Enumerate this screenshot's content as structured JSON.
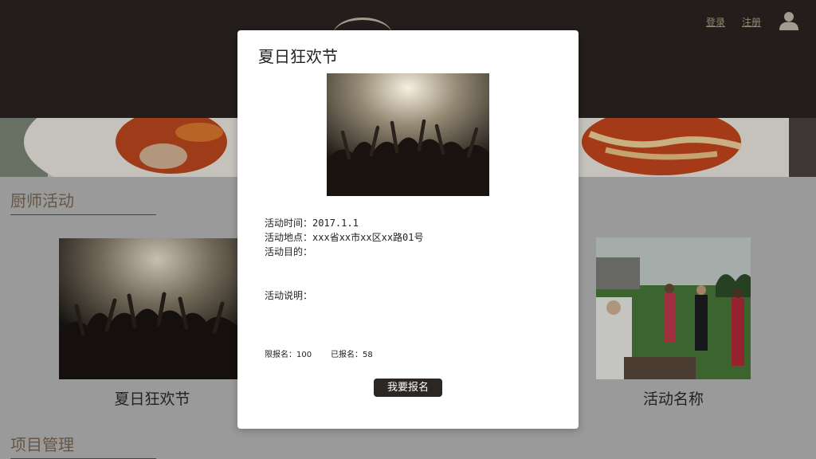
{
  "header": {
    "login_label": "登录",
    "register_label": "注册",
    "avatar_icon": "user-icon"
  },
  "sections": {
    "chef_activities": "厨师活动",
    "project_management": "项目管理"
  },
  "cards": [
    {
      "title": "夏日狂欢节",
      "image": "concert-crowd-photo"
    },
    {
      "title": "活动名称",
      "image": "outdoor-party-photo"
    }
  ],
  "modal": {
    "title": "夏日狂欢节",
    "image": "concert-crowd-photo",
    "time_label": "活动时间：",
    "time_value": "2017.1.1",
    "location_label": "活动地点：",
    "location_value": "xxx省xx市xx区xx路01号",
    "purpose_label": "活动目的：",
    "description_label": "活动说明：",
    "limit_label": "限报名：",
    "limit_value": "100",
    "registered_label": "已报名：",
    "registered_value": "58",
    "signup_button": "我要报名"
  },
  "colors": {
    "header_bg": "#2b2522",
    "accent_gold": "#b5a387",
    "section_title": "#7c6a53",
    "button_bg": "#2d2724"
  }
}
